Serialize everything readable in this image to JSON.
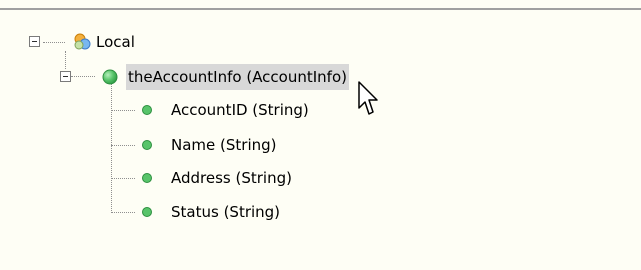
{
  "tree": {
    "root": {
      "label": "Local",
      "icon": "local-variables-icon"
    },
    "child": {
      "label": "theAccountInfo (AccountInfo)",
      "icon": "green-circle-icon"
    },
    "fields": [
      {
        "label": "AccountID (String)",
        "icon": "field-dot-icon"
      },
      {
        "label": "Name (String)",
        "icon": "field-dot-icon"
      },
      {
        "label": "Address (String)",
        "icon": "field-dot-icon"
      },
      {
        "label": "Status (String)",
        "icon": "field-dot-icon"
      }
    ]
  },
  "colors": {
    "panel_background": "#fefef5",
    "selection_background": "#d8d8d8",
    "tree_line": "#8f8f8f",
    "green_icon": "#58c46a"
  },
  "cursor": {
    "icon": "mouse-pointer-icon"
  }
}
